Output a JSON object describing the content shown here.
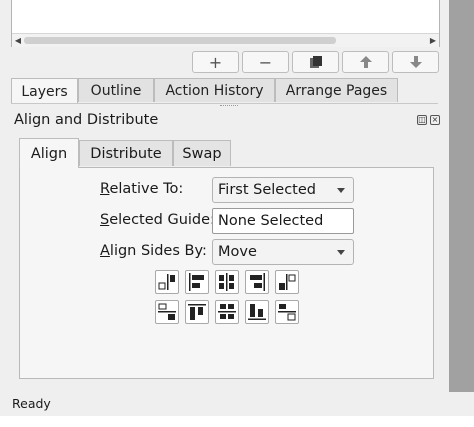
{
  "dock_tabs": [
    "Layers",
    "Outline",
    "Action History",
    "Arrange Pages"
  ],
  "panel": {
    "title": "Align and Distribute",
    "tabs": [
      "Align",
      "Distribute",
      "Swap"
    ]
  },
  "form": {
    "relative_to": {
      "label_first": "R",
      "label_rest": "elative To:",
      "value": "First Selected"
    },
    "selected_guide": {
      "label_first": "S",
      "label_rest": "elected Guide:",
      "value": "None Selected"
    },
    "align_sides_by": {
      "label_first": "A",
      "label_rest": "lign Sides By:",
      "value": "Move"
    }
  },
  "status": {
    "text": "Ready"
  },
  "icons": {
    "toolbar": [
      "plus-icon",
      "minus-icon",
      "duplicate-icon",
      "arrow-up-icon",
      "arrow-down-icon"
    ],
    "align_row1": [
      "align-right-of-anchor-icon",
      "align-left-edges-icon",
      "center-horizontally-icon",
      "align-right-edges-icon",
      "align-left-of-anchor-icon"
    ],
    "align_row2": [
      "align-below-anchor-icon",
      "align-top-edges-icon",
      "center-vertically-icon",
      "align-bottom-edges-icon",
      "align-above-anchor-icon"
    ]
  }
}
